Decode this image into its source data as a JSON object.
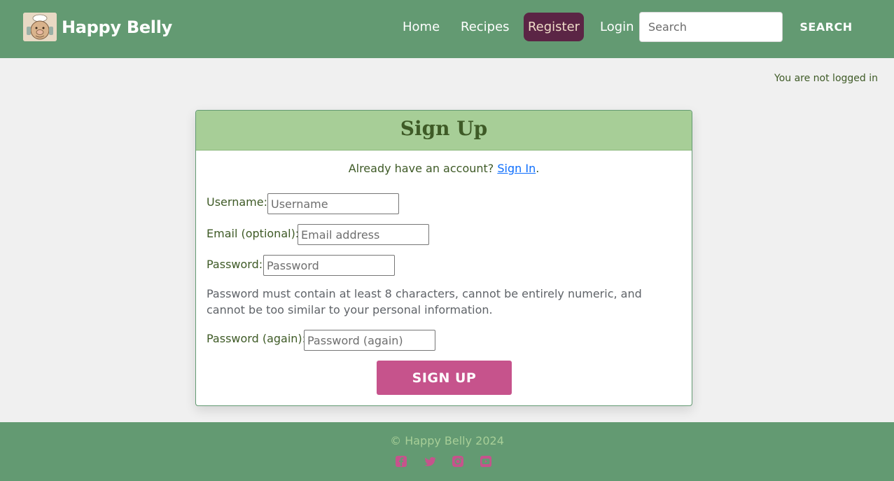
{
  "navbar": {
    "brand_name": "Happy Belly",
    "logo_icon": "chef-pig-logo",
    "links": {
      "home": "Home",
      "recipes": "Recipes",
      "register": "Register",
      "login": "Login"
    },
    "active_link": "Register",
    "search_placeholder": "Search",
    "search_button": "SEARCH"
  },
  "login_status": "You are not logged in",
  "signup_card": {
    "title": "Sign Up",
    "signin_prompt": "Already have an account?",
    "signin_link": "Sign In",
    "signin_suffix": ".",
    "fields": {
      "username": {
        "label": "Username:",
        "placeholder": "Username",
        "value": ""
      },
      "email": {
        "label": "Email (optional):",
        "placeholder": "Email address",
        "value": ""
      },
      "password": {
        "label": "Password:",
        "placeholder": "Password",
        "value": ""
      },
      "password_again": {
        "label": "Password (again):",
        "placeholder": "Password (again)",
        "value": ""
      }
    },
    "password_help": "Password must contain at least 8 characters, cannot be entirely numeric, and cannot be too similar to your personal information.",
    "submit_label": "SIGN UP"
  },
  "footer": {
    "copyright": "© Happy Belly 2024",
    "social_icons": [
      "facebook-icon",
      "twitter-icon",
      "instagram-icon",
      "youtube-icon"
    ]
  },
  "colors": {
    "nav_green": "#639a72",
    "card_header_green": "#a7ce97",
    "text_dark_green": "#3e5a26",
    "register_active_bg": "#5b2545",
    "accent_pink": "#c6538c",
    "link_blue": "#0d6efd",
    "page_bg": "#f0f0f0"
  }
}
